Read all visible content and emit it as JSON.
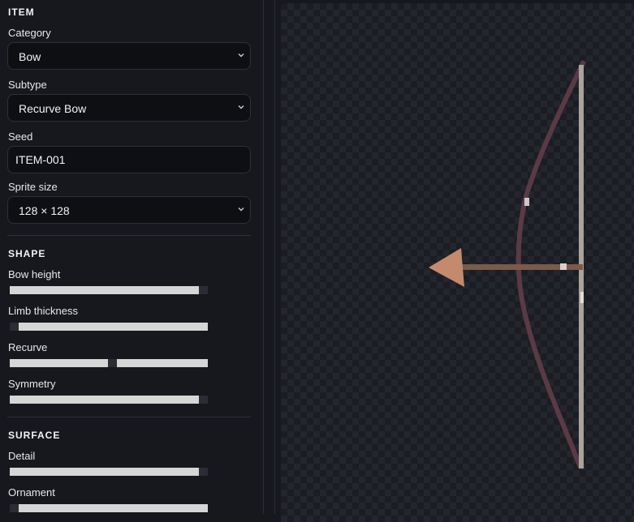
{
  "item_section": {
    "title": "ITEM",
    "category": {
      "label": "Category",
      "value": "Bow"
    },
    "subtype": {
      "label": "Subtype",
      "value": "Recurve Bow"
    },
    "seed": {
      "label": "Seed",
      "value": "ITEM-001"
    },
    "sprite_size": {
      "label": "Sprite size",
      "value": "128 × 128"
    }
  },
  "shape_section": {
    "title": "SHAPE",
    "sliders": [
      {
        "label": "Bow height",
        "value": 100
      },
      {
        "label": "Limb thickness",
        "value": 0
      },
      {
        "label": "Recurve",
        "value": 52
      },
      {
        "label": "Symmetry",
        "value": 100
      }
    ]
  },
  "surface_section": {
    "title": "SURFACE",
    "sliders": [
      {
        "label": "Detail",
        "value": 100
      },
      {
        "label": "Ornament",
        "value": 0
      }
    ]
  },
  "colors": {
    "bow_limb": "#5a3a44",
    "bow_string": "#a8a39c",
    "arrow_shaft": "#7a5a4a",
    "arrow_head": "#c48a6e"
  }
}
